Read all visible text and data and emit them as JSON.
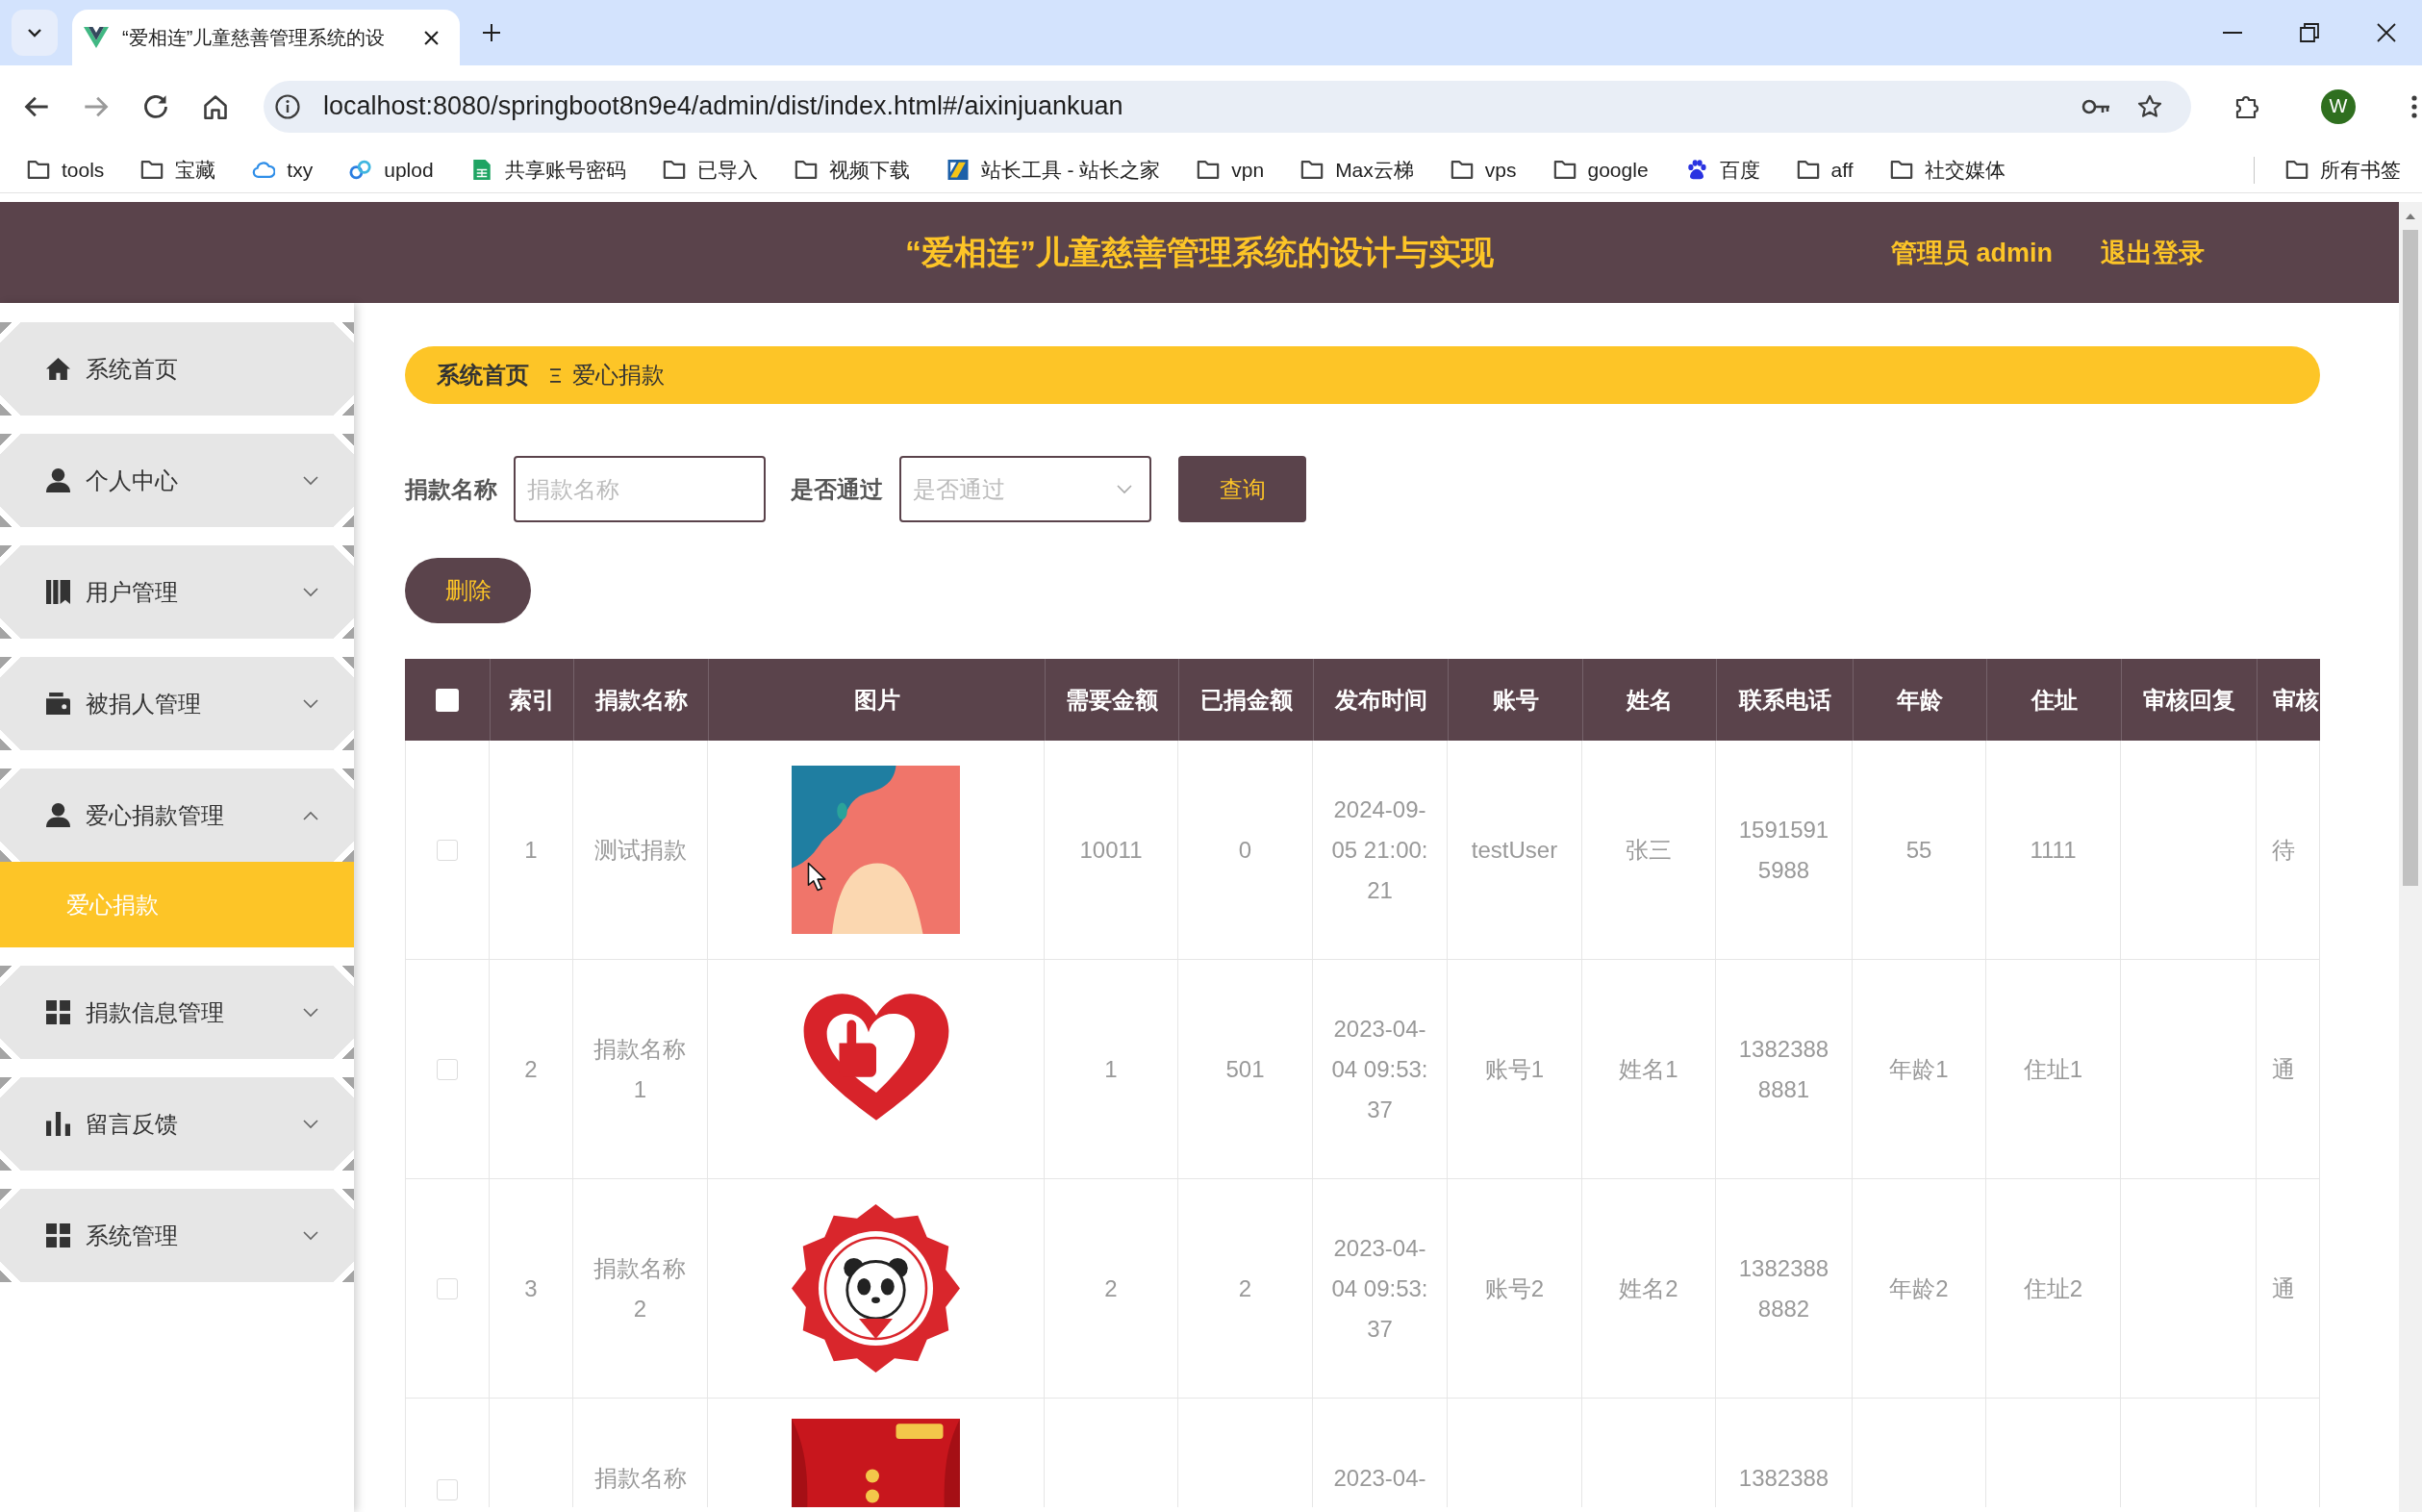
{
  "browser": {
    "tabs": [
      {
        "title": "“爱相连”儿童慈善管理系统的设",
        "selected": true
      }
    ],
    "address": "localhost:8080/springboot8n9e4/admin/dist/index.html#/aixinjuankuan",
    "profile_initial": "W",
    "bookmarks": [
      {
        "label": "tools",
        "kind": "folder"
      },
      {
        "label": "宝藏",
        "kind": "folder"
      },
      {
        "label": "txy",
        "kind": "link"
      },
      {
        "label": "uplod",
        "kind": "link"
      },
      {
        "label": "共享账号密码",
        "kind": "link"
      },
      {
        "label": "已导入",
        "kind": "folder"
      },
      {
        "label": "视频下载",
        "kind": "folder"
      },
      {
        "label": "站长工具 - 站长之家",
        "kind": "link"
      },
      {
        "label": "vpn",
        "kind": "folder"
      },
      {
        "label": "Max云梯",
        "kind": "folder"
      },
      {
        "label": "vps",
        "kind": "folder"
      },
      {
        "label": "google",
        "kind": "folder"
      },
      {
        "label": "百度",
        "kind": "link"
      },
      {
        "label": "aff",
        "kind": "folder"
      },
      {
        "label": "社交媒体",
        "kind": "folder"
      }
    ],
    "all_bookmarks": "所有书签"
  },
  "header": {
    "title": "“爱相连”儿童慈善管理系统的设计与实现",
    "user": "管理员 admin",
    "logout": "退出登录"
  },
  "sidebar": {
    "items": [
      {
        "label": "系统首页",
        "selected": false
      },
      {
        "label": "个人中心",
        "selected": false,
        "expanded": false
      },
      {
        "label": "用户管理",
        "selected": false,
        "expanded": false
      },
      {
        "label": "被捐人管理",
        "selected": false,
        "expanded": false
      },
      {
        "label": "爱心捐款管理",
        "selected": false,
        "expanded": true,
        "children": [
          {
            "label": "爱心捐款",
            "selected": true
          }
        ]
      },
      {
        "label": "捐款信息管理",
        "selected": false,
        "expanded": false
      },
      {
        "label": "留言反馈",
        "selected": false,
        "expanded": false
      },
      {
        "label": "系统管理",
        "selected": false,
        "expanded": false
      }
    ]
  },
  "breadcrumb": [
    {
      "label": "系统首页"
    },
    {
      "label": "爱心捐款"
    }
  ],
  "filters": [
    {
      "kind": "input",
      "label": "捐款名称",
      "placeholder": "捐款名称"
    },
    {
      "kind": "select",
      "label": "是否通过",
      "placeholder": "是否通过"
    }
  ],
  "search_button": "查询",
  "delete_button": "删除",
  "table": {
    "all_selected": false,
    "columns": [
      "索引",
      "捐款名称",
      "图片",
      "需要金额",
      "已捐金额",
      "发布时间",
      "账号",
      "姓名",
      "联系电话",
      "年龄",
      "住址",
      "审核回复",
      "审核"
    ],
    "rows": [
      {
        "selected": false,
        "index": "1",
        "name": "测试捐款",
        "picture": {
          "kind": "illustration"
        },
        "amount_needed": "10011",
        "amount_donated": "0",
        "published": "2024-09-05 21:00:21",
        "account": "testUser",
        "person_name": "张三",
        "phone": "15915915988",
        "age": "55",
        "address": "1111",
        "review": "待"
      },
      {
        "selected": false,
        "index": "2",
        "name": "捐款名称1",
        "picture": {
          "kind": "heart-logo"
        },
        "amount_needed": "1",
        "amount_donated": "501",
        "published": "2023-04-04 09:53:37",
        "account": "账号1",
        "person_name": "姓名1",
        "phone": "13823888881",
        "age": "年龄1",
        "address": "住址1",
        "review": "通"
      },
      {
        "selected": false,
        "index": "3",
        "name": "捐款名称2",
        "picture": {
          "kind": "badge-logo"
        },
        "amount_needed": "2",
        "amount_donated": "2",
        "published": "2023-04-04 09:53:37",
        "account": "账号2",
        "person_name": "姓名2",
        "phone": "13823888882",
        "age": "年龄2",
        "address": "住址2",
        "review": "通"
      },
      {
        "selected": false,
        "name": "捐款名称",
        "picture": {
          "kind": "poster"
        },
        "published": "2023-04-",
        "phone": "1382388"
      }
    ]
  }
}
